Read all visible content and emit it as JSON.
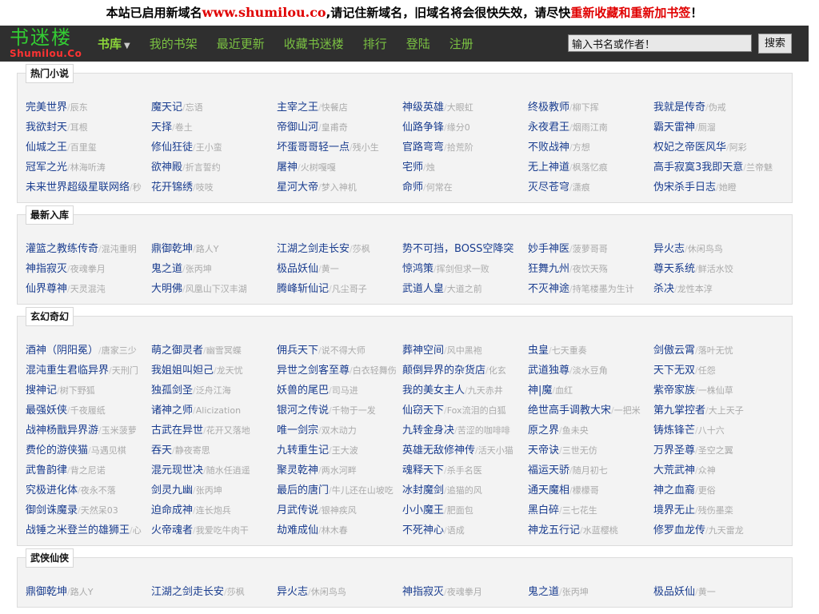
{
  "notice": {
    "prefix": "本站已启用新域名",
    "domain": "www.shumilou.co",
    "middle": ",请记住新域名，旧域名将会很快失效，请尽快",
    "warning": "重新收藏和重新加书签",
    "suffix": "！"
  },
  "logo": {
    "cn": "书迷楼",
    "en": "Shumilou.Co"
  },
  "menu": [
    "书库",
    "我的书架",
    "最近更新",
    "收藏书迷楼",
    "排行",
    "登陆",
    "注册"
  ],
  "search": {
    "placeholder": "输入书名或作者！",
    "button": "搜索"
  },
  "sections": [
    {
      "title": "热门小说",
      "books": [
        {
          "title": "完美世界",
          "author": "辰东"
        },
        {
          "title": "魔天记",
          "author": "忘语"
        },
        {
          "title": "主宰之王",
          "author": "快餐店"
        },
        {
          "title": "神级英雄",
          "author": "大眼虹"
        },
        {
          "title": "终极教师",
          "author": "柳下挥"
        },
        {
          "title": "我就是传奇",
          "author": "伪戒"
        },
        {
          "title": "我欲封天",
          "author": "耳根"
        },
        {
          "title": "天择",
          "author": "卷土"
        },
        {
          "title": "帝御山河",
          "author": "皇甫奇"
        },
        {
          "title": "仙路争锋",
          "author": "缘分0"
        },
        {
          "title": "永夜君王",
          "author": "烟雨江南"
        },
        {
          "title": "霸天雷神",
          "author": "厕溜"
        },
        {
          "title": "仙城之王",
          "author": "百里玺"
        },
        {
          "title": "修仙狂徒",
          "author": "王小蛮"
        },
        {
          "title": "坏蛋哥哥轻一点",
          "author": "残小生"
        },
        {
          "title": "官路弯弯",
          "author": "拾荒阶"
        },
        {
          "title": "不败战神",
          "author": "方想"
        },
        {
          "title": "权妃之帝医风华",
          "author": "阿彩"
        },
        {
          "title": "冠军之光",
          "author": "林海听涛"
        },
        {
          "title": "欲神殿",
          "author": "折言誓约"
        },
        {
          "title": "屠神",
          "author": "火树嘎嘎"
        },
        {
          "title": "宅师",
          "author": "烛"
        },
        {
          "title": "无上神道",
          "author": "枫落忆痕"
        },
        {
          "title": "高手寂寞3我即天意",
          "author": "兰帝魅"
        },
        {
          "title": "未来世界超级星联网络",
          "author": "秒"
        },
        {
          "title": "花开锦绣",
          "author": "吱吱"
        },
        {
          "title": "星河大帝",
          "author": "梦入神机"
        },
        {
          "title": "命师",
          "author": "何常在"
        },
        {
          "title": "灭尽苍穹",
          "author": "潇痕"
        },
        {
          "title": "伪宋杀手日志",
          "author": "她瞪"
        }
      ]
    },
    {
      "title": "最新入库",
      "books": [
        {
          "title": "灌篮之教练传奇",
          "author": "混沌重明"
        },
        {
          "title": "鼎御乾坤",
          "author": "路人Y"
        },
        {
          "title": "江湖之剑走长安",
          "author": "莎枫"
        },
        {
          "title": "势不可挡，BOSS空降突",
          "author": ""
        },
        {
          "title": "妙手神医",
          "author": "菠萝哥哥"
        },
        {
          "title": "异火志",
          "author": "休闲鸟鸟"
        },
        {
          "title": "神指寂灭",
          "author": "夜魂拳月"
        },
        {
          "title": "鬼之道",
          "author": "张丙坤"
        },
        {
          "title": "极品妖仙",
          "author": "黄一"
        },
        {
          "title": "惊鸿策",
          "author": "挥剑但求一败"
        },
        {
          "title": "狂舞九州",
          "author": "夜饮天殇"
        },
        {
          "title": "尊天系统",
          "author": "鲜活水饺"
        },
        {
          "title": "仙界尊神",
          "author": "天灵混沌"
        },
        {
          "title": "大明佛",
          "author": "风凰山下汉丰湖"
        },
        {
          "title": "腾峰斩仙记",
          "author": "凡尘哥子"
        },
        {
          "title": "武道人皇",
          "author": "大道之前"
        },
        {
          "title": "不灭神途",
          "author": "持笔楼墨为生计"
        },
        {
          "title": "杀决",
          "author": "龙性本淳"
        }
      ]
    },
    {
      "title": "玄幻奇幻",
      "books": [
        {
          "title": "酒神（阴阳冕）",
          "author": "唐家三少"
        },
        {
          "title": "萌之御灵者",
          "author": "幽雪冥蝶"
        },
        {
          "title": "佣兵天下",
          "author": "说不得大师"
        },
        {
          "title": "葬神空间",
          "author": "风中黑袍"
        },
        {
          "title": "虫皇",
          "author": "七天重奏"
        },
        {
          "title": "剑傲云霄",
          "author": "落叶无忧"
        },
        {
          "title": "混沌重生君临异界",
          "author": "天刑门"
        },
        {
          "title": "我姐姐叫妲己",
          "author": "龙天忧"
        },
        {
          "title": "异世之剑客至尊",
          "author": "白衣轻舞伤"
        },
        {
          "title": "颠倒异界的杂货店",
          "author": "化玄"
        },
        {
          "title": "武道独尊",
          "author": "淡水豆角"
        },
        {
          "title": "天下无双",
          "author": "任怨"
        },
        {
          "title": "搜神记",
          "author": "树下野狐"
        },
        {
          "title": "独孤剑圣",
          "author": "泛舟江海"
        },
        {
          "title": "妖兽的尾巴",
          "author": "司马进"
        },
        {
          "title": "我的美女主人",
          "author": "九天赤井"
        },
        {
          "title": "神|魔",
          "author": "血红"
        },
        {
          "title": "紫帝家族",
          "author": "一株仙草"
        },
        {
          "title": "最强妖侠",
          "author": "千夜履纸"
        },
        {
          "title": "诸神之师",
          "author": "Alicization"
        },
        {
          "title": "银河之传说",
          "author": "千物于一发"
        },
        {
          "title": "仙窃天下",
          "author": "Fox流泪的白狐"
        },
        {
          "title": "绝世高手调教大宋",
          "author": "一把米"
        },
        {
          "title": "第九掌控者",
          "author": "大上天子"
        },
        {
          "title": "战神杨戬异界游",
          "author": "玉米菠萝"
        },
        {
          "title": "古武在异世",
          "author": "花开又落地"
        },
        {
          "title": "唯一剑宗",
          "author": "双木动力"
        },
        {
          "title": "九转金身决",
          "author": "苦涩的咖啡啡"
        },
        {
          "title": "原之界",
          "author": "鱼未央"
        },
        {
          "title": "铸炼锋芒",
          "author": "八十六"
        },
        {
          "title": "费伦的游侠猫",
          "author": "马遇见棋"
        },
        {
          "title": "吞天",
          "author": "静夜寄思"
        },
        {
          "title": "九转重生记",
          "author": "王大波"
        },
        {
          "title": "英雄无敌修神传",
          "author": "活天小猫"
        },
        {
          "title": "天帝诀",
          "author": "三世无仿"
        },
        {
          "title": "万界圣尊",
          "author": "圣空之翼"
        },
        {
          "title": "武鲁韵律",
          "author": "背之尼诺"
        },
        {
          "title": "混元现世决",
          "author": "随水任逍遥"
        },
        {
          "title": "聚灵乾神",
          "author": "两水河畔"
        },
        {
          "title": "魂释天下",
          "author": "杀手名医"
        },
        {
          "title": "福运天骄",
          "author": "随月初七"
        },
        {
          "title": "大荒武神",
          "author": "众神"
        },
        {
          "title": "究极进化体",
          "author": "夜永不落"
        },
        {
          "title": "剑灵九幽",
          "author": "张丙坤"
        },
        {
          "title": "最后的唐门",
          "author": "牛儿还在山坡吃"
        },
        {
          "title": "冰封魔剑",
          "author": "追猫的风"
        },
        {
          "title": "通天魔相",
          "author": "檬檬哥"
        },
        {
          "title": "神之血裔",
          "author": "更俗"
        },
        {
          "title": "御剑诛魔录",
          "author": "天然呆03"
        },
        {
          "title": "迫命成神",
          "author": "连长炮兵"
        },
        {
          "title": "月武传说",
          "author": "银神疾风"
        },
        {
          "title": "小小魔王",
          "author": "肥面包"
        },
        {
          "title": "黑白碎",
          "author": "三七花生"
        },
        {
          "title": "境界无止",
          "author": "残伤墨栾"
        },
        {
          "title": "战锤之米登兰的雄狮王",
          "author": "心"
        },
        {
          "title": "火帝魂者",
          "author": "我爱吃牛肉干"
        },
        {
          "title": "劫难成仙",
          "author": "林木春"
        },
        {
          "title": "不死神心",
          "author": "语成"
        },
        {
          "title": "神龙五行记",
          "author": "水蓝樱桃"
        },
        {
          "title": "修罗血龙传",
          "author": "九天雷龙"
        }
      ]
    },
    {
      "title": "武侠仙侠",
      "books": [
        {
          "title": "鼎御乾坤",
          "author": "路人Y"
        },
        {
          "title": "江湖之剑走长安",
          "author": "莎枫"
        },
        {
          "title": "异火志",
          "author": "休闲鸟鸟"
        },
        {
          "title": "神指寂灭",
          "author": "夜魂拳月"
        },
        {
          "title": "鬼之道",
          "author": "张丙坤"
        },
        {
          "title": "极品妖仙",
          "author": "黄一"
        }
      ]
    }
  ]
}
